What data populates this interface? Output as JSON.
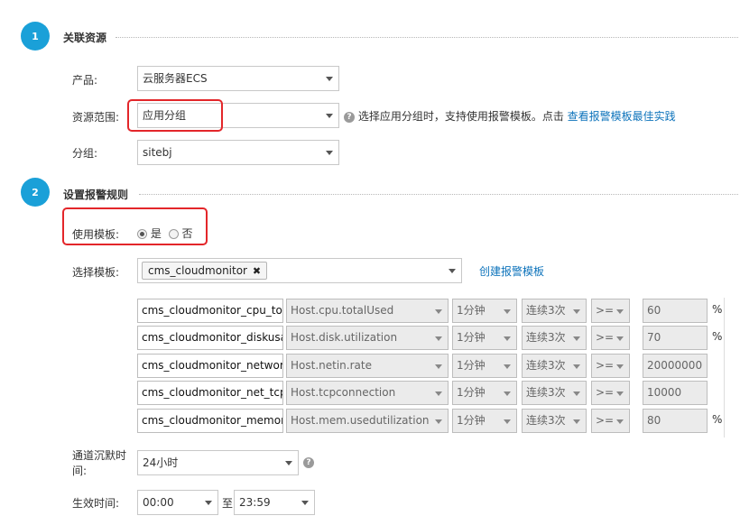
{
  "sections": [
    {
      "number": "1",
      "title": "关联资源"
    },
    {
      "number": "2",
      "title": "设置报警规则"
    }
  ],
  "resource": {
    "product_label": "产品:",
    "product_value": "云服务器ECS",
    "scope_label": "资源范围:",
    "scope_value": "应用分组",
    "scope_help_text": "选择应用分组时，支持使用报警模板。点击",
    "scope_help_link": "查看报警模板最佳实践",
    "group_label": "分组:",
    "group_value": "sitebj"
  },
  "alarm": {
    "use_template_label": "使用模板:",
    "use_template_options": [
      {
        "label": "是",
        "selected": true
      },
      {
        "label": "否",
        "selected": false
      }
    ],
    "choose_template_label": "选择模板:",
    "template_tag": "cms_cloudmonitor",
    "template_tag_remove": "✖",
    "create_template_link": "创建报警模板",
    "rules": [
      {
        "name": "cms_cloudmonitor_cpu_total",
        "metric": "Host.cpu.totalUsed",
        "period": "1分钟",
        "times": "连续3次",
        "operator": ">=",
        "threshold": "60",
        "unit": "%"
      },
      {
        "name": "cms_cloudmonitor_diskusage",
        "metric": "Host.disk.utilization",
        "period": "1分钟",
        "times": "连续3次",
        "operator": ">=",
        "threshold": "70",
        "unit": "%"
      },
      {
        "name": "cms_cloudmonitor_networkin",
        "metric": "Host.netin.rate",
        "period": "1分钟",
        "times": "连续3次",
        "operator": ">=",
        "threshold": "20000000",
        "unit": ""
      },
      {
        "name": "cms_cloudmonitor_net_tcpcc",
        "metric": "Host.tcpconnection",
        "period": "1分钟",
        "times": "连续3次",
        "operator": ">=",
        "threshold": "10000",
        "unit": ""
      },
      {
        "name": "cms_cloudmonitor_memory_",
        "metric": "Host.mem.usedutilization",
        "period": "1分钟",
        "times": "连续3次",
        "operator": ">=",
        "threshold": "80",
        "unit": "%"
      }
    ],
    "silence_label_line1": "通道沉默时",
    "silence_label_line2": "间:",
    "silence_value": "24小时",
    "effective_label": "生效时间:",
    "effective_start": "00:00",
    "effective_to": "至",
    "effective_end": "23:59"
  },
  "colors": {
    "accent": "#1aa0d8",
    "highlight": "#e3262a",
    "link": "#0d73bb"
  },
  "icons": {
    "help": "question-circle-icon",
    "dropdown": "caret-down-icon",
    "remove": "close-icon"
  }
}
